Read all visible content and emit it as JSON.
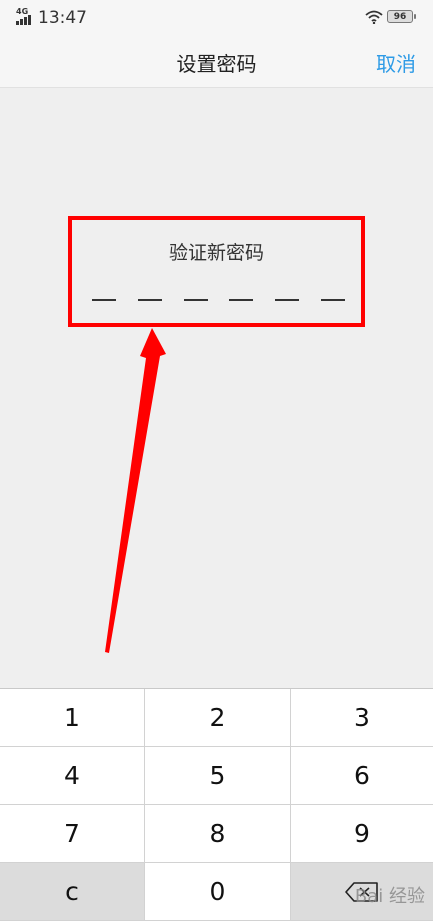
{
  "statusbar": {
    "network": "4G",
    "time": "13:47",
    "battery": "96"
  },
  "nav": {
    "title": "设置密码",
    "cancel": "取消"
  },
  "verify": {
    "title": "验证新密码",
    "pin_length": 6
  },
  "keypad": {
    "keys": [
      "1",
      "2",
      "3",
      "4",
      "5",
      "6",
      "7",
      "8",
      "9",
      "c",
      "0",
      "backspace"
    ]
  },
  "watermark": {
    "text": "Bai 经验"
  },
  "colors": {
    "accent": "#2e9be6",
    "annotation": "#ff0000"
  }
}
